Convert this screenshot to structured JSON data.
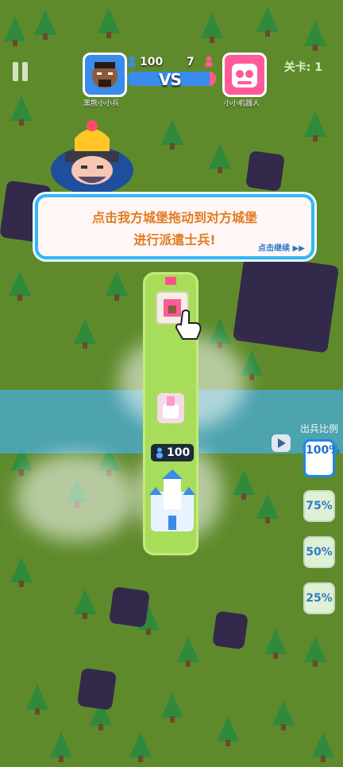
{
  "hud": {
    "player_name": "黑熊小小兵",
    "player_score": "100",
    "enemy_score": "7",
    "enemy_name": "小小机器人",
    "vs_text": "VS",
    "level_text": "关卡: 1",
    "player_share": 0.93
  },
  "tutorial": {
    "line1": "点击我方城堡拖动到对方城堡",
    "line2": "进行派遣士兵!",
    "continue_text": "点击继续 ▶▶"
  },
  "lane": {
    "own_troops": "100"
  },
  "ratio_panel": {
    "title": "出兵比例",
    "options": [
      "100%",
      "75%",
      "50%",
      "25%"
    ],
    "selected": "100%"
  },
  "colors": {
    "player": "#3a8bea",
    "enemy": "#ff5a8a",
    "accent": "#e07b20"
  },
  "icons": {
    "pause": "pause-icon",
    "player_person": "person-icon",
    "enemy_person": "person-icon",
    "play": "play-icon",
    "hand": "pointer-hand-icon"
  }
}
